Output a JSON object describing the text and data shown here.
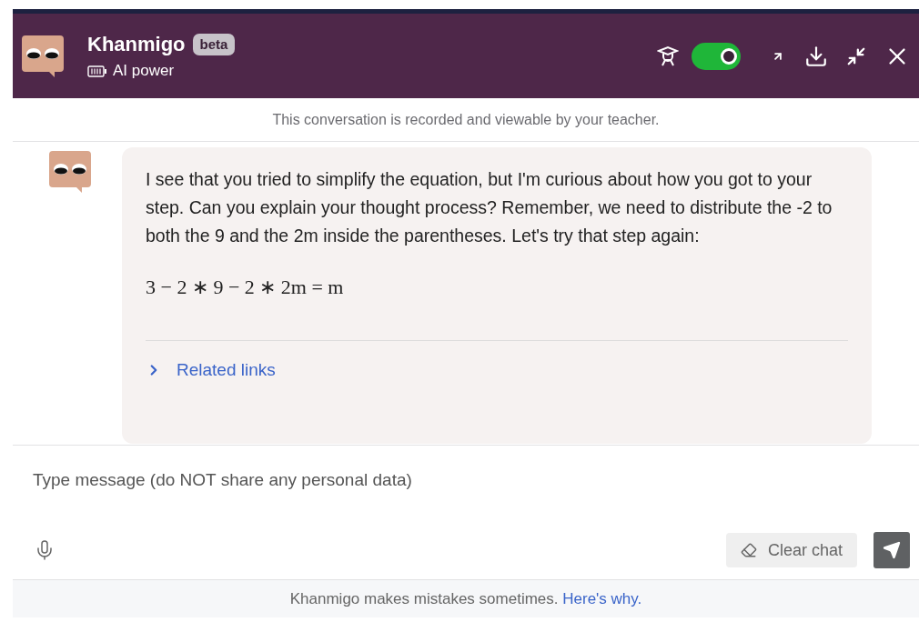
{
  "header": {
    "title": "Khanmigo",
    "badge": "beta",
    "subtitle": "AI power",
    "teacher_mode": {
      "on": true
    }
  },
  "notice": "This conversation is recorded and viewable by your teacher.",
  "message": {
    "text": "I see that you tried to simplify the equation, but I'm curious about how you got to your step. Can you explain your thought process? Remember, we need to distribute the -2 to both the 9 and the 2m inside the parentheses. Let's try that step again:",
    "equation": "3 − 2 ∗ 9 − 2 ∗ 2m = m",
    "related_links": {
      "label": "Related links",
      "expanded": false
    }
  },
  "composer": {
    "placeholder": "Type message (do NOT share any personal data)",
    "clear_button": "Clear chat"
  },
  "footer": {
    "text": "Khanmigo makes mistakes sometimes.",
    "link": "Here's why."
  }
}
